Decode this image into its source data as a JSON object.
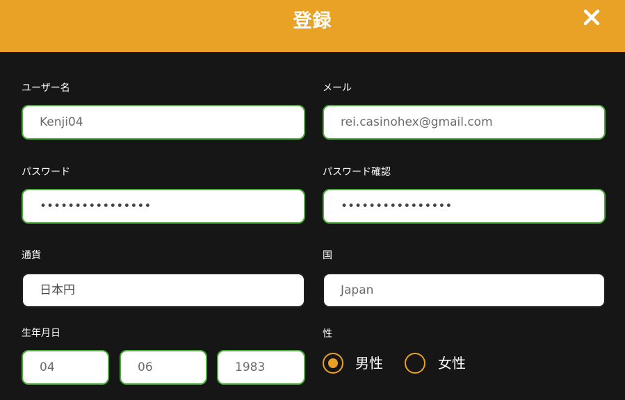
{
  "dialog": {
    "title": "登録",
    "close_icon": "close-icon",
    "accent_color": "#e9a225"
  },
  "form": {
    "username": {
      "label": "ユーザー名",
      "value": "Kenji04"
    },
    "email": {
      "label": "メール",
      "value": "rei.casinohex@gmail.com"
    },
    "password": {
      "label": "パスワード",
      "value": "••••••••••••••••"
    },
    "password_confirm": {
      "label": "パスワード確認",
      "value": "••••••••••••••••"
    },
    "currency": {
      "label": "通貨",
      "value": "日本円"
    },
    "country": {
      "label": "国",
      "value": "Japan"
    },
    "birthdate": {
      "label": "生年月日",
      "day": "04",
      "month": "06",
      "year": "1983"
    },
    "gender": {
      "label": "性",
      "options": [
        {
          "label": "男性",
          "selected": true
        },
        {
          "label": "女性",
          "selected": false
        }
      ]
    }
  }
}
